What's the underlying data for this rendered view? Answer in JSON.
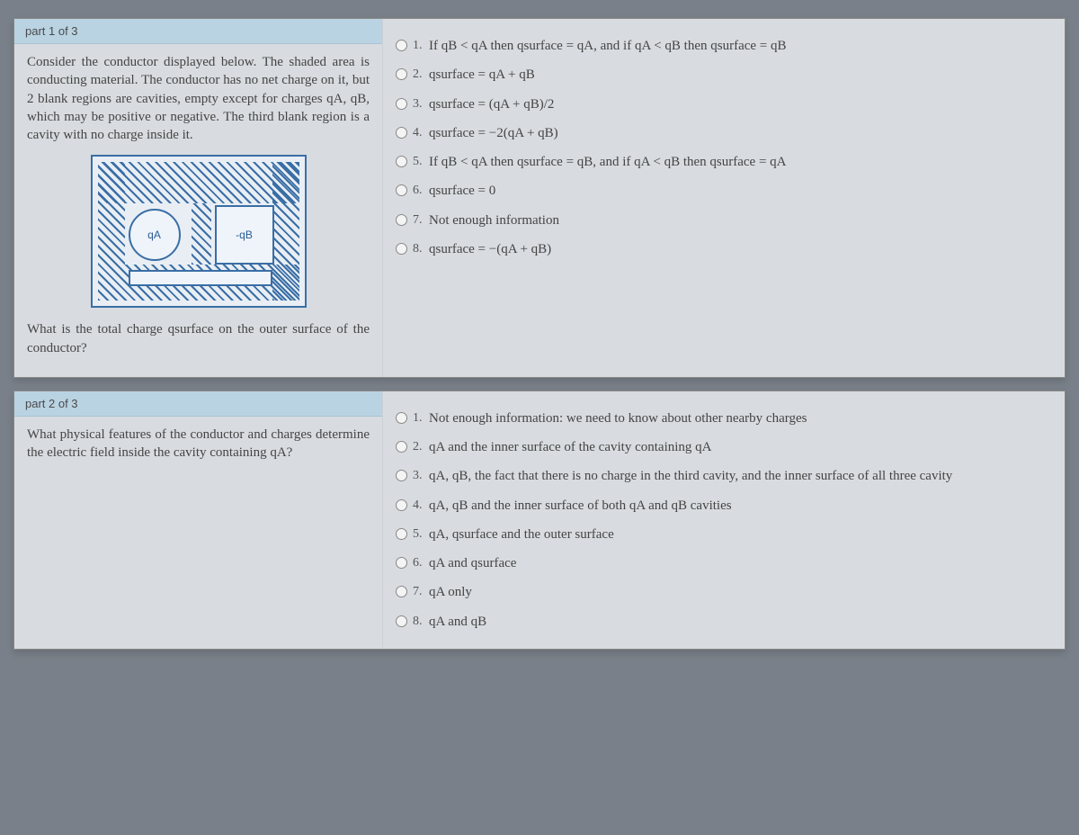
{
  "part1": {
    "header": "part 1 of 3",
    "question": "Consider the conductor displayed below. The shaded area is conducting material. The conductor has no net charge on it, but 2 blank regions are cavities, empty except for charges qA, qB, which may be positive or negative. The third blank region is a cavity with no charge inside it.",
    "figA": "qA",
    "figB": "-qB",
    "question2": "What is the total charge qsurface on the outer surface of the conductor?",
    "opts": {
      "1": "If qB < qA then qsurface = qA, and if qA < qB then qsurface = qB",
      "2": "qsurface = qA + qB",
      "3": "qsurface = (qA + qB)/2",
      "4": "qsurface = −2(qA + qB)",
      "5": "If qB < qA then qsurface = qB, and if qA < qB then qsurface = qA",
      "6": "qsurface = 0",
      "7": "Not enough information",
      "8": "qsurface = −(qA + qB)"
    }
  },
  "part2": {
    "header": "part 2 of 3",
    "question": "What physical features of the conductor and charges determine the electric field inside the cavity containing qA?",
    "opts": {
      "1": "Not enough information: we need to know about other nearby charges",
      "2": "qA and the inner surface of the cavity containing qA",
      "3": "qA, qB, the fact that there is no charge in the third cavity, and the inner surface of all three cavity",
      "4": "qA, qB and the inner surface of both qA and qB cavities",
      "5": "qA, qsurface and the outer surface",
      "6": "qA and qsurface",
      "7": "qA only",
      "8": "qA and qB"
    }
  }
}
